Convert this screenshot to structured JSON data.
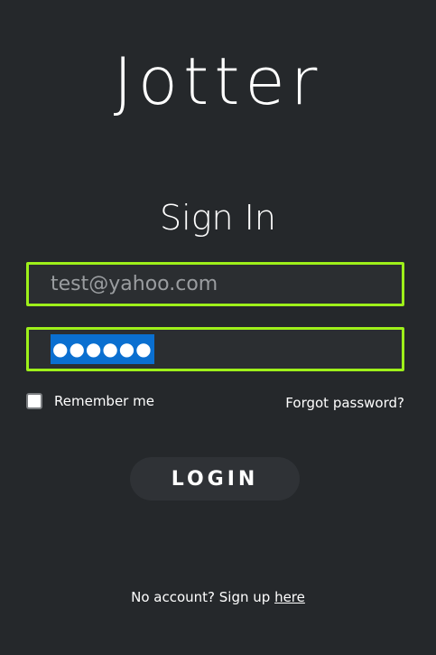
{
  "app": {
    "logo": "Jotter"
  },
  "form": {
    "heading": "Sign In",
    "email": {
      "placeholder": "test@yahoo.com",
      "value": ""
    },
    "password": {
      "masked_value": "●●●●●●",
      "selected": true
    },
    "remember_label": "Remember me",
    "remember_checked": false,
    "forgot_label": "Forgot password?",
    "login_label": "LOGIN"
  },
  "footer": {
    "prompt": "No account? Sign up ",
    "link_label": "here"
  },
  "colors": {
    "background": "#25282b",
    "field_border": "#9ef01a",
    "selection": "#0a6fd0"
  }
}
